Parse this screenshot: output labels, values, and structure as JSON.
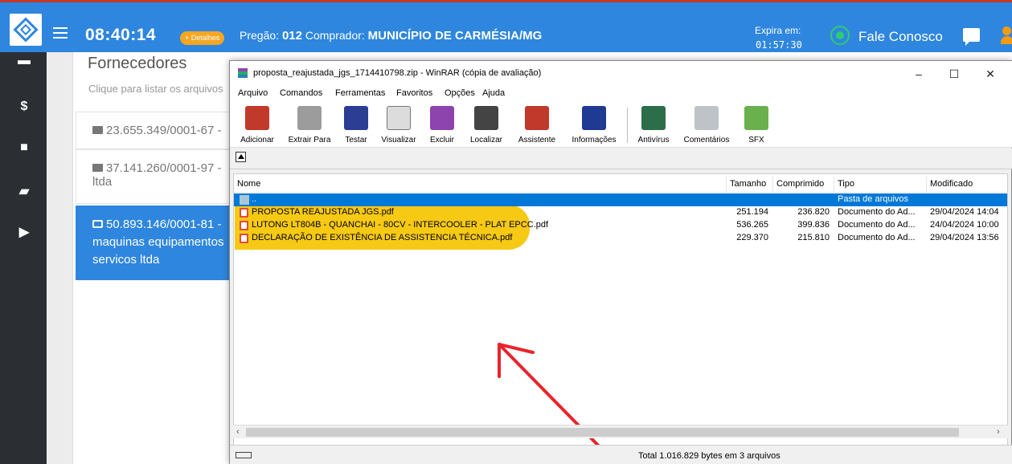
{
  "topbar": {
    "clock": "08:40:14",
    "details_label": "+ Detalhes",
    "pregao_label": "Pregão:",
    "pregao_number": "012",
    "comprador_label": "Comprador:",
    "comprador_name": "MUNICÍPIO DE CARMÉSIA/MG",
    "expira_label": "Expira em:",
    "expira_time": "01:57:30",
    "fale_conosco": "Fale Conosco",
    "accent_color": "#2e86de"
  },
  "leftnav": {
    "items": [
      {
        "icon": "book-icon"
      },
      {
        "icon": "dollar-icon",
        "glyph": "$"
      },
      {
        "icon": "folder-icon"
      },
      {
        "icon": "notebook-icon"
      },
      {
        "icon": "folder-open-icon"
      }
    ]
  },
  "panel": {
    "title": "Fornecedores",
    "subtitle": "Clique para listar os arquivos",
    "suppliers": [
      {
        "line1": "23.655.349/0001-67 -",
        "line2": ""
      },
      {
        "line1": "37.141.260/0001-97 -",
        "line2": "ltda"
      },
      {
        "line1": "50.893.146/0001-81 -",
        "line2": "maquinas equipamentos",
        "line3": "servicos ltda"
      }
    ]
  },
  "winrar": {
    "title": "proposta_reajustada_jgs_1714410798.zip - WinRAR (cópia de avaliação)",
    "controls": {
      "minimize": "–",
      "maximize": "☐",
      "close": "✕"
    },
    "menu": [
      "Arquivo",
      "Comandos",
      "Ferramentas",
      "Favoritos",
      "Opções",
      "Ajuda"
    ],
    "toolbar": [
      {
        "label": "Adicionar",
        "icon": "add-archive-icon",
        "color": "#c0392b"
      },
      {
        "label": "Extrair Para",
        "icon": "extract-icon",
        "color": "#8e8e8e"
      },
      {
        "label": "Testar",
        "icon": "test-icon",
        "color": "#2c3e94"
      },
      {
        "label": "Visualizar",
        "icon": "view-icon",
        "color": "#7a7a7a"
      },
      {
        "label": "Excluir",
        "icon": "delete-icon",
        "color": "#8e44ad"
      },
      {
        "label": "Localizar",
        "icon": "find-icon",
        "color": "#555555"
      },
      {
        "label": "Assistente",
        "icon": "wizard-icon",
        "color": "#c0392b"
      },
      {
        "label": "Informações",
        "icon": "info-icon",
        "color": "#1f3a93"
      },
      {
        "label": "Antivírus",
        "icon": "antivirus-icon",
        "color": "#2c6e49"
      },
      {
        "label": "Comentários",
        "icon": "comment-icon",
        "color": "#95a5a6"
      },
      {
        "label": "SFX",
        "icon": "sfx-icon",
        "color": "#6ab04c"
      }
    ],
    "columns": [
      "Nome",
      "Tamanho",
      "Comprimido",
      "Tipo",
      "Modificado"
    ],
    "rows": [
      {
        "name": "..",
        "size": "",
        "packed": "",
        "type": "Pasta de arquivos",
        "modified": "",
        "selected": true
      },
      {
        "name": "PROPOSTA REAJUSTADA JGS.pdf",
        "size": "251.194",
        "packed": "236.820",
        "type": "Documento do Ad...",
        "modified": "29/04/2024 14:04"
      },
      {
        "name": "LUTONG LT804B - QUANCHAI - 80CV - INTERCOOLER - PLAT EPCC.pdf",
        "size": "536.265",
        "packed": "399.836",
        "type": "Documento do Ad...",
        "modified": "24/04/2024 10:00"
      },
      {
        "name": "DECLARAÇÃO DE EXISTÊNCIA DE ASSISTENCIA TÉCNICA.pdf",
        "size": "229.370",
        "packed": "215.810",
        "type": "Documento do Ad...",
        "modified": "29/04/2024 13:56"
      }
    ],
    "status": "Total 1.016.829 bytes em 3 arquivos",
    "highlight_color": "#f5c400"
  },
  "annotation": {
    "arrow_color": "#e8242b"
  }
}
